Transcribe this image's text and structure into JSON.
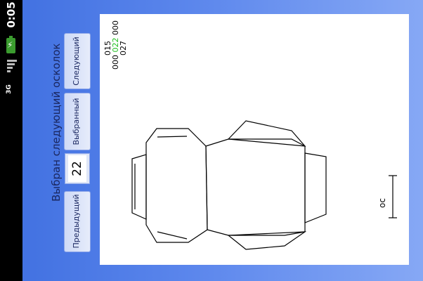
{
  "status_bar": {
    "time": "0:05",
    "network": "3G",
    "battery_glyph": "⚡"
  },
  "header": {
    "title": "Выбран следующий осколок"
  },
  "controls": {
    "prev_label": "Предыдущий",
    "number_value": "22",
    "selected_label": "Выбранный",
    "next_label": "Следующий"
  },
  "canvas": {
    "codes": {
      "line1": "015",
      "line2_prefix": "000 ",
      "line2_highlight": "022",
      "line2_suffix": " 000",
      "line3": "027"
    },
    "scale_label": "ос"
  },
  "colors": {
    "background": "#5b86ec",
    "title": "#1a2760",
    "highlight": "#1fbf1f"
  }
}
